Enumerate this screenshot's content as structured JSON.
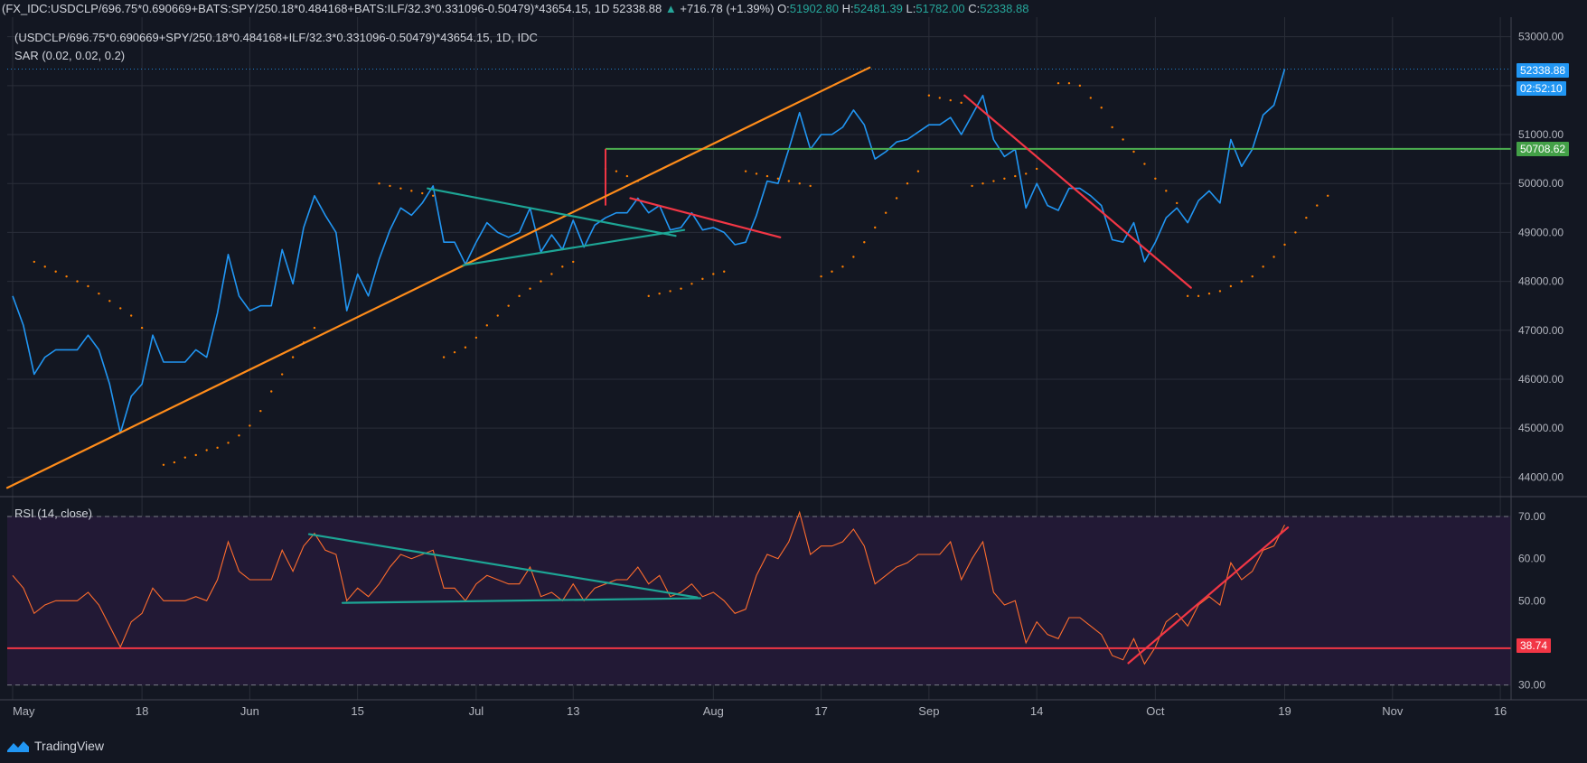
{
  "header": {
    "symbol": "(FX_IDC:USDCLP/696.75*0.690669+BATS:SPY/250.18*0.484168+BATS:ILF/32.3*0.331096-0.50479)*43654.15, 1D",
    "last": "52338.88",
    "change": "+716.78 (+1.39%)",
    "o_label": "O:",
    "o_value": "51902.80",
    "h_label": "H:",
    "h_value": "52481.39",
    "l_label": "L:",
    "l_value": "51782.00",
    "c_label": "C:",
    "c_value": "52338.88"
  },
  "legend": {
    "main": "(USDCLP/696.75*0.690669+SPY/250.18*0.484168+ILF/32.3*0.331096-0.50479)*43654.15, 1D, IDC",
    "sar": "SAR (0.02, 0.02, 0.2)",
    "rsi": "RSI (14, close)"
  },
  "tags": {
    "last_price": "52338.88",
    "countdown": "02:52:10",
    "green_level": "50708.62",
    "rsi_level": "38.74"
  },
  "branding": "TradingView",
  "colors": {
    "background": "#131722",
    "price_line": "#2196f3",
    "sar": "#ff7f00",
    "orange_trend": "#ff8c1a",
    "red_trend": "#f23645",
    "teal_triangle": "#1da595",
    "green_level": "#4caf50",
    "rsi_line": "#ff6d2d",
    "rsi_band": "#221935",
    "grid": "#2a2e39"
  },
  "chart_data": [
    {
      "type": "line",
      "title": "(USDCLP/696.75*0.690669+SPY/250.18*0.484168+ILF/32.3*0.331096-0.50479)*43654.15, 1D, IDC",
      "ylim": [
        43600,
        53400
      ],
      "yticks": [
        44000,
        45000,
        46000,
        47000,
        48000,
        49000,
        50000,
        51000,
        52000,
        53000
      ],
      "ytick_labels": [
        "44000.00",
        "45000.00",
        "46000.00",
        "47000.00",
        "48000.00",
        "49000.00",
        "50000.00",
        "51000.00",
        "52000.00",
        "53000.00"
      ],
      "xticks": [
        {
          "label": "May",
          "i": 0
        },
        {
          "label": "18",
          "i": 12
        },
        {
          "label": "Jun",
          "i": 22
        },
        {
          "label": "15",
          "i": 32
        },
        {
          "label": "Jul",
          "i": 43
        },
        {
          "label": "13",
          "i": 52
        },
        {
          "label": "Aug",
          "i": 65
        },
        {
          "label": "17",
          "i": 75
        },
        {
          "label": "Sep",
          "i": 85
        },
        {
          "label": "14",
          "i": 95
        },
        {
          "label": "Oct",
          "i": 106
        },
        {
          "label": "19",
          "i": 118
        },
        {
          "label": "Nov",
          "i": 128
        },
        {
          "label": "16",
          "i": 138
        }
      ],
      "xrange": [
        -0.5,
        139
      ],
      "grid": true,
      "series": [
        {
          "role": "price",
          "values": [
            47700,
            47100,
            46100,
            46450,
            46600,
            46600,
            46600,
            46900,
            46600,
            45900,
            44900,
            45650,
            45900,
            46900,
            46350,
            46350,
            46350,
            46600,
            46450,
            47350,
            48550,
            47700,
            47400,
            47500,
            47500,
            48650,
            47950,
            49100,
            49750,
            49350,
            49000,
            47400,
            48150,
            47700,
            48450,
            49050,
            49500,
            49350,
            49600,
            49950,
            48800,
            48800,
            48350,
            48800,
            49200,
            49000,
            48900,
            49000,
            49500,
            48600,
            48950,
            48650,
            49250,
            48700,
            49150,
            49300,
            49400,
            49400,
            49700,
            49400,
            49550,
            49050,
            49100,
            49400,
            49050,
            49100,
            49000,
            48750,
            48800,
            49350,
            50050,
            50000,
            50700,
            51450,
            50700,
            51000,
            51000,
            51150,
            51500,
            51200,
            50500,
            50650,
            50850,
            50900,
            51050,
            51200,
            51200,
            51350,
            51000,
            51400,
            51800,
            50900,
            50550,
            50700,
            49500,
            50000,
            49550,
            49450,
            49900,
            49900,
            49750,
            49550,
            48850,
            48800,
            49200,
            48400,
            48800,
            49300,
            49500,
            49200,
            49650,
            49850,
            49600,
            50900,
            50350,
            50700,
            51400,
            51600,
            52339
          ]
        },
        {
          "role": "sar",
          "type": "scatter",
          "points": [
            [
              2,
              48400
            ],
            [
              3,
              48300
            ],
            [
              4,
              48200
            ],
            [
              5,
              48100
            ],
            [
              6,
              48000
            ],
            [
              7,
              47900
            ],
            [
              8,
              47750
            ],
            [
              9,
              47600
            ],
            [
              10,
              47450
            ],
            [
              11,
              47300
            ],
            [
              12,
              47050
            ],
            [
              14,
              44250
            ],
            [
              15,
              44300
            ],
            [
              16,
              44400
            ],
            [
              17,
              44450
            ],
            [
              18,
              44550
            ],
            [
              19,
              44600
            ],
            [
              20,
              44700
            ],
            [
              21,
              44850
            ],
            [
              22,
              45050
            ],
            [
              23,
              45350
            ],
            [
              24,
              45750
            ],
            [
              25,
              46100
            ],
            [
              26,
              46450
            ],
            [
              27,
              46750
            ],
            [
              28,
              47050
            ],
            [
              34,
              50000
            ],
            [
              35,
              49950
            ],
            [
              36,
              49900
            ],
            [
              37,
              49850
            ],
            [
              38,
              49800
            ],
            [
              39,
              49750
            ],
            [
              40,
              46450
            ],
            [
              41,
              46550
            ],
            [
              42,
              46650
            ],
            [
              43,
              46850
            ],
            [
              44,
              47100
            ],
            [
              45,
              47300
            ],
            [
              46,
              47500
            ],
            [
              47,
              47700
            ],
            [
              48,
              47850
            ],
            [
              49,
              48000
            ],
            [
              50,
              48150
            ],
            [
              51,
              48300
            ],
            [
              52,
              48400
            ],
            [
              55,
              50300
            ],
            [
              56,
              50250
            ],
            [
              57,
              50150
            ],
            [
              58,
              50050
            ],
            [
              59,
              47700
            ],
            [
              60,
              47750
            ],
            [
              61,
              47800
            ],
            [
              62,
              47850
            ],
            [
              63,
              47950
            ],
            [
              64,
              48050
            ],
            [
              65,
              48150
            ],
            [
              66,
              48200
            ],
            [
              68,
              50250
            ],
            [
              69,
              50200
            ],
            [
              70,
              50150
            ],
            [
              71,
              50100
            ],
            [
              72,
              50050
            ],
            [
              73,
              50000
            ],
            [
              74,
              49950
            ],
            [
              75,
              48100
            ],
            [
              76,
              48200
            ],
            [
              77,
              48300
            ],
            [
              78,
              48500
            ],
            [
              79,
              48800
            ],
            [
              80,
              49100
            ],
            [
              81,
              49400
            ],
            [
              82,
              49700
            ],
            [
              83,
              50000
            ],
            [
              84,
              50250
            ],
            [
              85,
              51800
            ],
            [
              86,
              51750
            ],
            [
              87,
              51700
            ],
            [
              88,
              51650
            ],
            [
              89,
              49950
            ],
            [
              90,
              50000
            ],
            [
              91,
              50050
            ],
            [
              92,
              50100
            ],
            [
              93,
              50150
            ],
            [
              94,
              50200
            ],
            [
              95,
              50300
            ],
            [
              97,
              52050
            ],
            [
              98,
              52050
            ],
            [
              99,
              52000
            ],
            [
              100,
              51750
            ],
            [
              101,
              51550
            ],
            [
              102,
              51150
            ],
            [
              103,
              50900
            ],
            [
              104,
              50650
            ],
            [
              105,
              50400
            ],
            [
              106,
              50100
            ],
            [
              107,
              49850
            ],
            [
              108,
              49600
            ],
            [
              109,
              47700
            ],
            [
              110,
              47700
            ],
            [
              111,
              47750
            ],
            [
              112,
              47800
            ],
            [
              113,
              47900
            ],
            [
              114,
              48000
            ],
            [
              115,
              48100
            ],
            [
              116,
              48300
            ],
            [
              117,
              48500
            ],
            [
              118,
              48750
            ],
            [
              119,
              49000
            ],
            [
              120,
              49300
            ],
            [
              121,
              49550
            ],
            [
              122,
              49750
            ]
          ]
        }
      ]
    },
    {
      "type": "line",
      "title": "RSI (14, close)",
      "ylim": [
        26.5,
        74.5
      ],
      "yticks": [
        30,
        40,
        50,
        60,
        70
      ],
      "ytick_labels": [
        "30.00",
        "40.00",
        "50.00",
        "60.00",
        "70.00"
      ],
      "band": [
        30,
        70
      ],
      "level_line": 38.74,
      "xrange": [
        -0.5,
        139
      ],
      "series": [
        {
          "role": "rsi",
          "values": [
            56,
            53,
            47,
            49,
            50,
            50,
            50,
            52,
            49,
            44,
            39,
            45,
            47,
            53,
            50,
            50,
            50,
            51,
            50,
            55,
            64,
            57,
            55,
            55,
            55,
            62,
            57,
            63,
            66,
            62,
            61,
            50,
            53,
            51,
            54,
            58,
            61,
            60,
            61,
            62,
            53,
            53,
            50,
            54,
            56,
            55,
            54,
            54,
            58,
            51,
            52,
            50,
            54,
            50,
            53,
            54,
            55,
            55,
            58,
            54,
            56,
            51,
            52,
            54,
            51,
            52,
            50,
            47,
            48,
            56,
            61,
            60,
            64,
            71,
            61,
            63,
            63,
            64,
            67,
            63,
            54,
            56,
            58,
            59,
            61,
            61,
            61,
            64,
            55,
            60,
            64,
            52,
            49,
            50,
            40,
            45,
            42,
            41,
            46,
            46,
            44,
            42,
            37,
            36,
            41,
            35,
            39,
            45,
            47,
            44,
            49,
            51,
            49,
            59,
            55,
            57,
            62,
            63,
            68
          ]
        }
      ]
    }
  ]
}
